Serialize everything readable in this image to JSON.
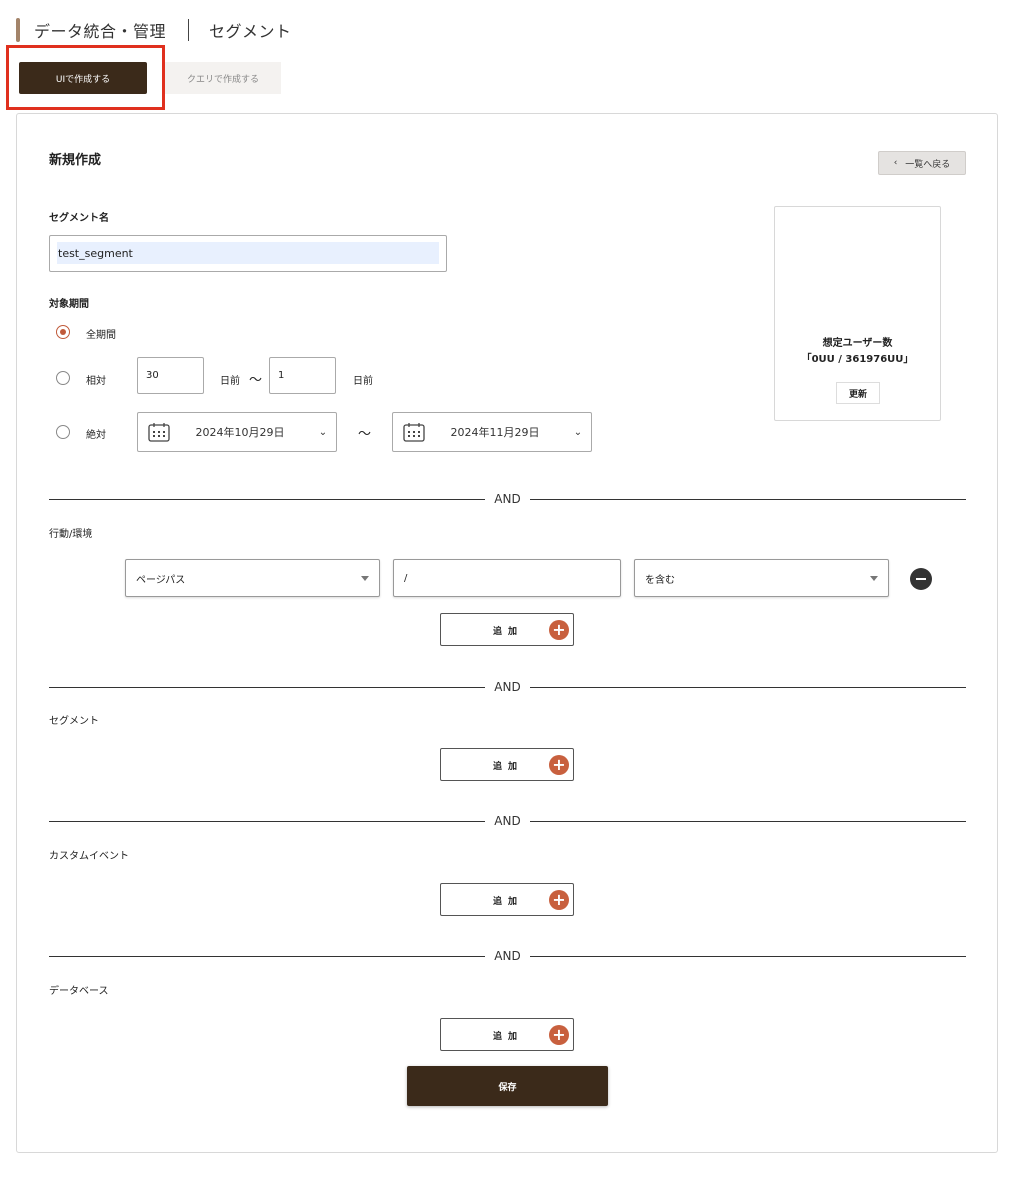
{
  "header": {
    "title": "データ統合・管理",
    "subtitle": "セグメント"
  },
  "tabs": [
    {
      "label": "UIで作成する",
      "active": true
    },
    {
      "label": "クエリで作成する",
      "active": false
    }
  ],
  "form": {
    "title": "新規作成",
    "back_label": "一覧へ戻る",
    "segment_name_label": "セグメント名",
    "segment_name_value": "test_segment",
    "period_label": "対象期間",
    "period": {
      "all_label": "全期間",
      "relative_label": "相対",
      "relative_from": "30",
      "relative_to": "1",
      "days_ago": "日前",
      "tilde": "〜",
      "absolute_label": "絶対",
      "date_from": "2024年10月29日",
      "date_to": "2024年11月29日",
      "selected": "all"
    },
    "estimate": {
      "title": "想定ユーザー数",
      "count": "「0UU / 361976UU」",
      "refresh_label": "更新"
    },
    "and_label": "AND",
    "behavior_label": "行動/環境",
    "condition": {
      "field": "ページパス",
      "value": "/",
      "operator": "を含む"
    },
    "add_label": "追加",
    "segment_label": "セグメント",
    "custom_event_label": "カスタムイベント",
    "database_label": "データベース",
    "save_label": "保存"
  },
  "colors": {
    "brand_dark": "#3b2a1a",
    "accent": "#c8603e",
    "highlight": "#e0301e"
  }
}
